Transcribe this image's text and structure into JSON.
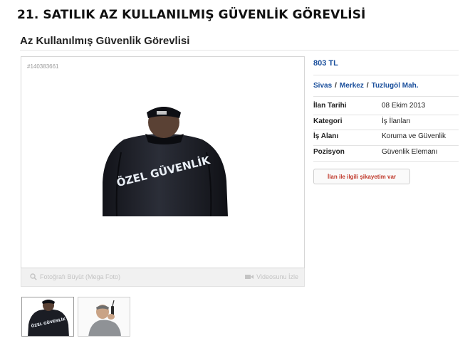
{
  "article": {
    "heading": "21. SATILIK AZ KULLANILMIŞ GÜVENLİK GÖREVLİSİ"
  },
  "listing": {
    "title": "Az Kullanılmış Güvenlik Görevlisi",
    "id": "#140383661",
    "jacket_text": "ÖZEL GÜVENLİK",
    "thumb_text": "ÖZEL GÜVENLİK",
    "photo_toolbar": {
      "mega_foto_label": "Fotoğrafı Büyüt (Mega Foto)",
      "video_label": "Videosunu İzle"
    },
    "price": "803 TL",
    "location": {
      "city": "Sivas",
      "district": "Merkez",
      "neighborhood": "Tuzlugöl Mah.",
      "separator": "/"
    },
    "details": [
      {
        "label": "İlan Tarihi",
        "value": "08 Ekim 2013"
      },
      {
        "label": "Kategori",
        "value": "İş İlanları"
      },
      {
        "label": "İş Alanı",
        "value": "Koruma ve Güvenlik"
      },
      {
        "label": "Pozisyon",
        "value": "Güvenlik Elemanı"
      }
    ],
    "complaint_label": "İlan ile ilgili şikayetim var"
  },
  "colors": {
    "link_blue": "#1a4f9c",
    "complaint_red": "#c0392b",
    "jacket": "#1d1f26"
  },
  "icons": {
    "mega_foto": "magnifier-icon",
    "video": "video-camera-icon"
  }
}
